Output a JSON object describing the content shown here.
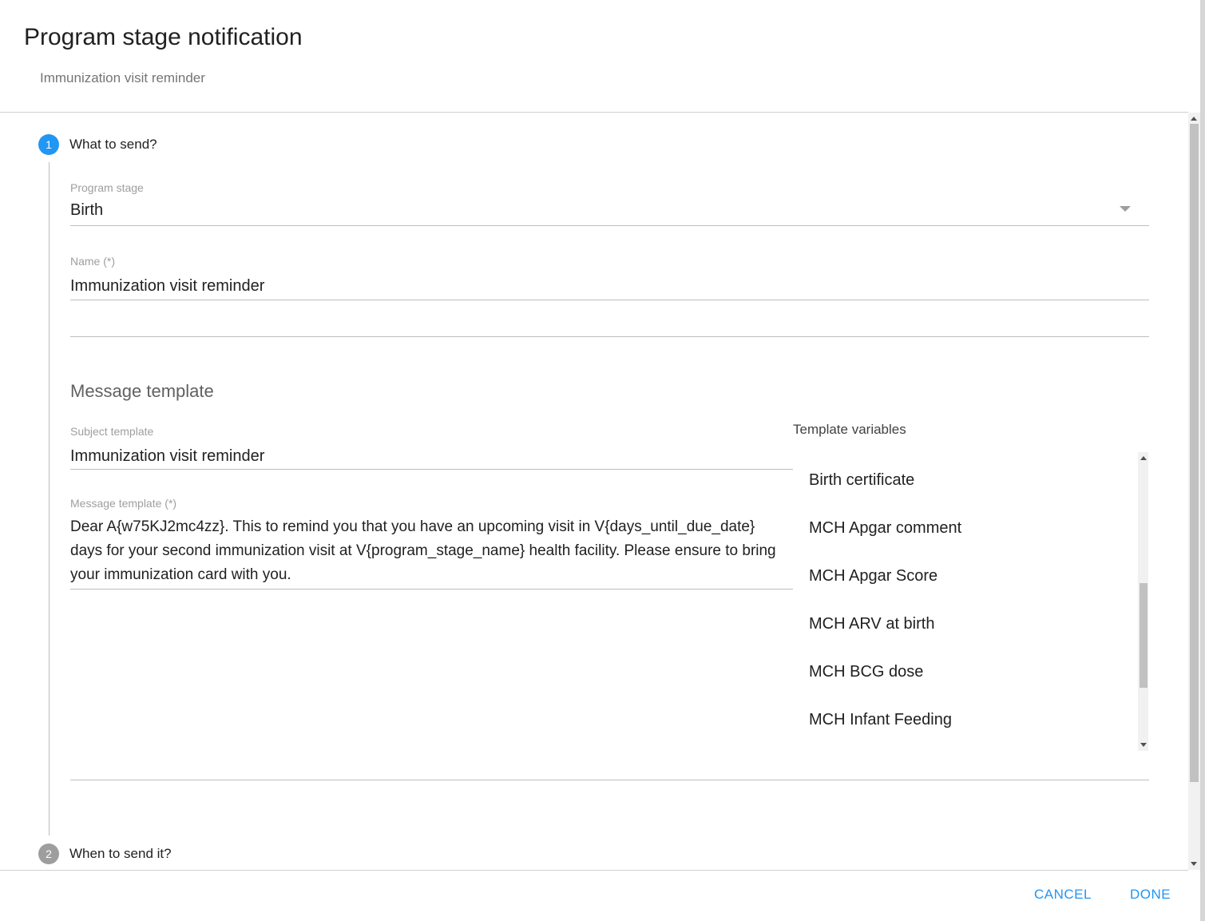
{
  "dialog": {
    "title": "Program stage notification",
    "subtitle": "Immunization visit reminder"
  },
  "steps": [
    {
      "number": "1",
      "label": "What to send?",
      "state": "active"
    },
    {
      "number": "2",
      "label": "When to send it?",
      "state": "inactive"
    }
  ],
  "form": {
    "program_stage": {
      "label": "Program stage",
      "value": "Birth"
    },
    "name": {
      "label": "Name (*)",
      "value": "Immunization visit reminder"
    },
    "message_section_heading": "Message template",
    "subject_template": {
      "label": "Subject template",
      "value": "Immunization visit reminder"
    },
    "message_template": {
      "label": "Message template (*)",
      "value": "Dear A{w75KJ2mc4zz}. This to remind you that you have an upcoming visit in V{days_until_due_date} days for your second immunization visit at V{program_stage_name} health facility. Please ensure to bring your immunization card with you."
    },
    "template_variables": {
      "label": "Template variables",
      "items": [
        "Birth certificate",
        "MCH Apgar comment",
        "MCH Apgar Score",
        "MCH ARV at birth",
        "MCH BCG dose",
        "MCH Infant Feeding"
      ]
    }
  },
  "actions": {
    "cancel": "CANCEL",
    "done": "DONE"
  },
  "colors": {
    "accent": "#2196f3",
    "inactive_step": "#9e9e9e"
  }
}
